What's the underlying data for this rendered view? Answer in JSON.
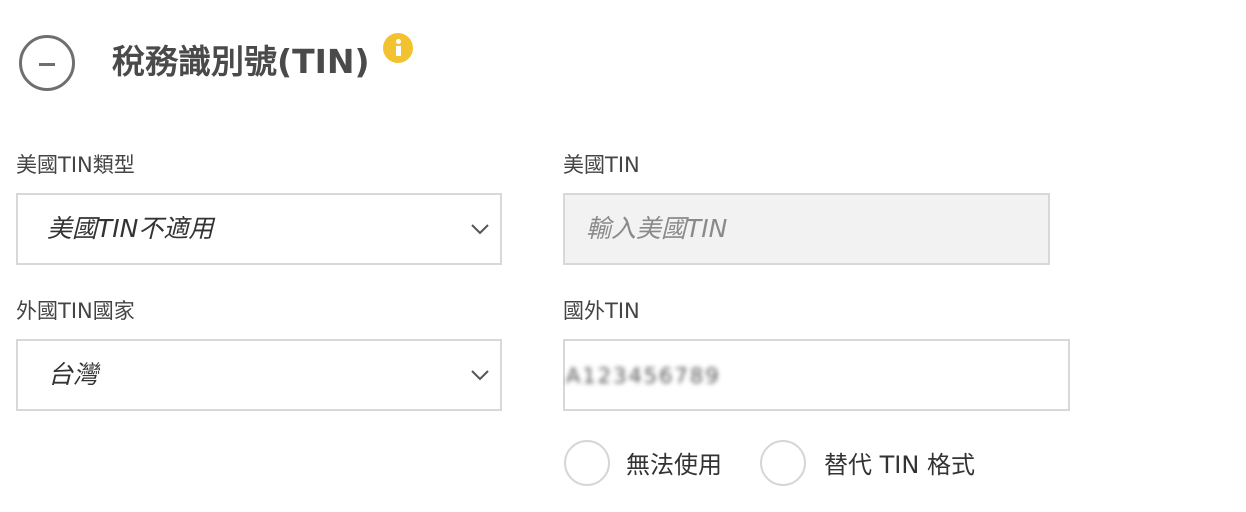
{
  "section": {
    "title": "稅務識別號(TIN)",
    "collapse_icon": "minus-circle-icon",
    "info_icon": "info-icon",
    "info_icon_color": "#f2c230"
  },
  "fields": {
    "us_tin_type": {
      "label": "美國TIN類型",
      "value": "美國TIN不適用",
      "icon": "chevron-down-icon"
    },
    "us_tin": {
      "label": "美國TIN",
      "placeholder": "輸入美國TIN"
    },
    "foreign_tin_country": {
      "label": "外國TIN國家",
      "value": "台灣",
      "icon": "chevron-down-icon"
    },
    "foreign_tin": {
      "label": "國外TIN",
      "value": "A123456789"
    }
  },
  "options": {
    "unavailable": "無法使用",
    "alternate_format": "替代 TIN 格式"
  }
}
